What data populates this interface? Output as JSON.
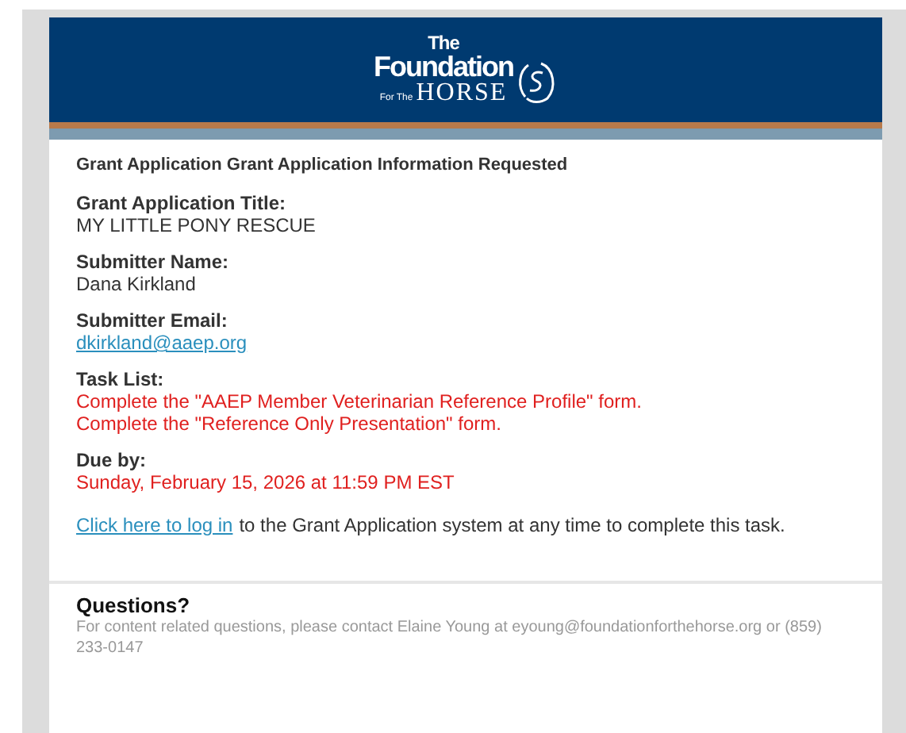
{
  "logo": {
    "line_1": "The",
    "line_2": "Foundation",
    "small": "For The",
    "big": "HORSE"
  },
  "heading": "Grant Application Grant Application Information Requested",
  "fields": [
    {
      "label": "Grant Application Title:",
      "kind": "text",
      "lines": [
        "MY LITTLE PONY RESCUE"
      ]
    },
    {
      "label": "Submitter Name:",
      "kind": "text",
      "lines": [
        "Dana Kirkland"
      ]
    },
    {
      "label": "Submitter Email:",
      "kind": "link",
      "lines": [
        "dkirkland@aaep.org"
      ]
    },
    {
      "label": "Task List:",
      "kind": "alert",
      "lines": [
        "Complete the \"AAEP Member Veterinarian Reference Profile\" form.",
        "Complete the \"Reference Only Presentation\" form."
      ]
    },
    {
      "label": "Due by:",
      "kind": "alert",
      "lines": [
        "Sunday, February 15, 2026 at 11:59 PM EST"
      ]
    }
  ],
  "login": {
    "link": "Click here to log in",
    "text": "to the Grant Application system at any time to complete this task."
  },
  "footer": {
    "title": "Questions?",
    "text": "For content related questions, please contact Elaine Young at eyoung@foundationforthehorse.org or (859) 233-0147"
  }
}
